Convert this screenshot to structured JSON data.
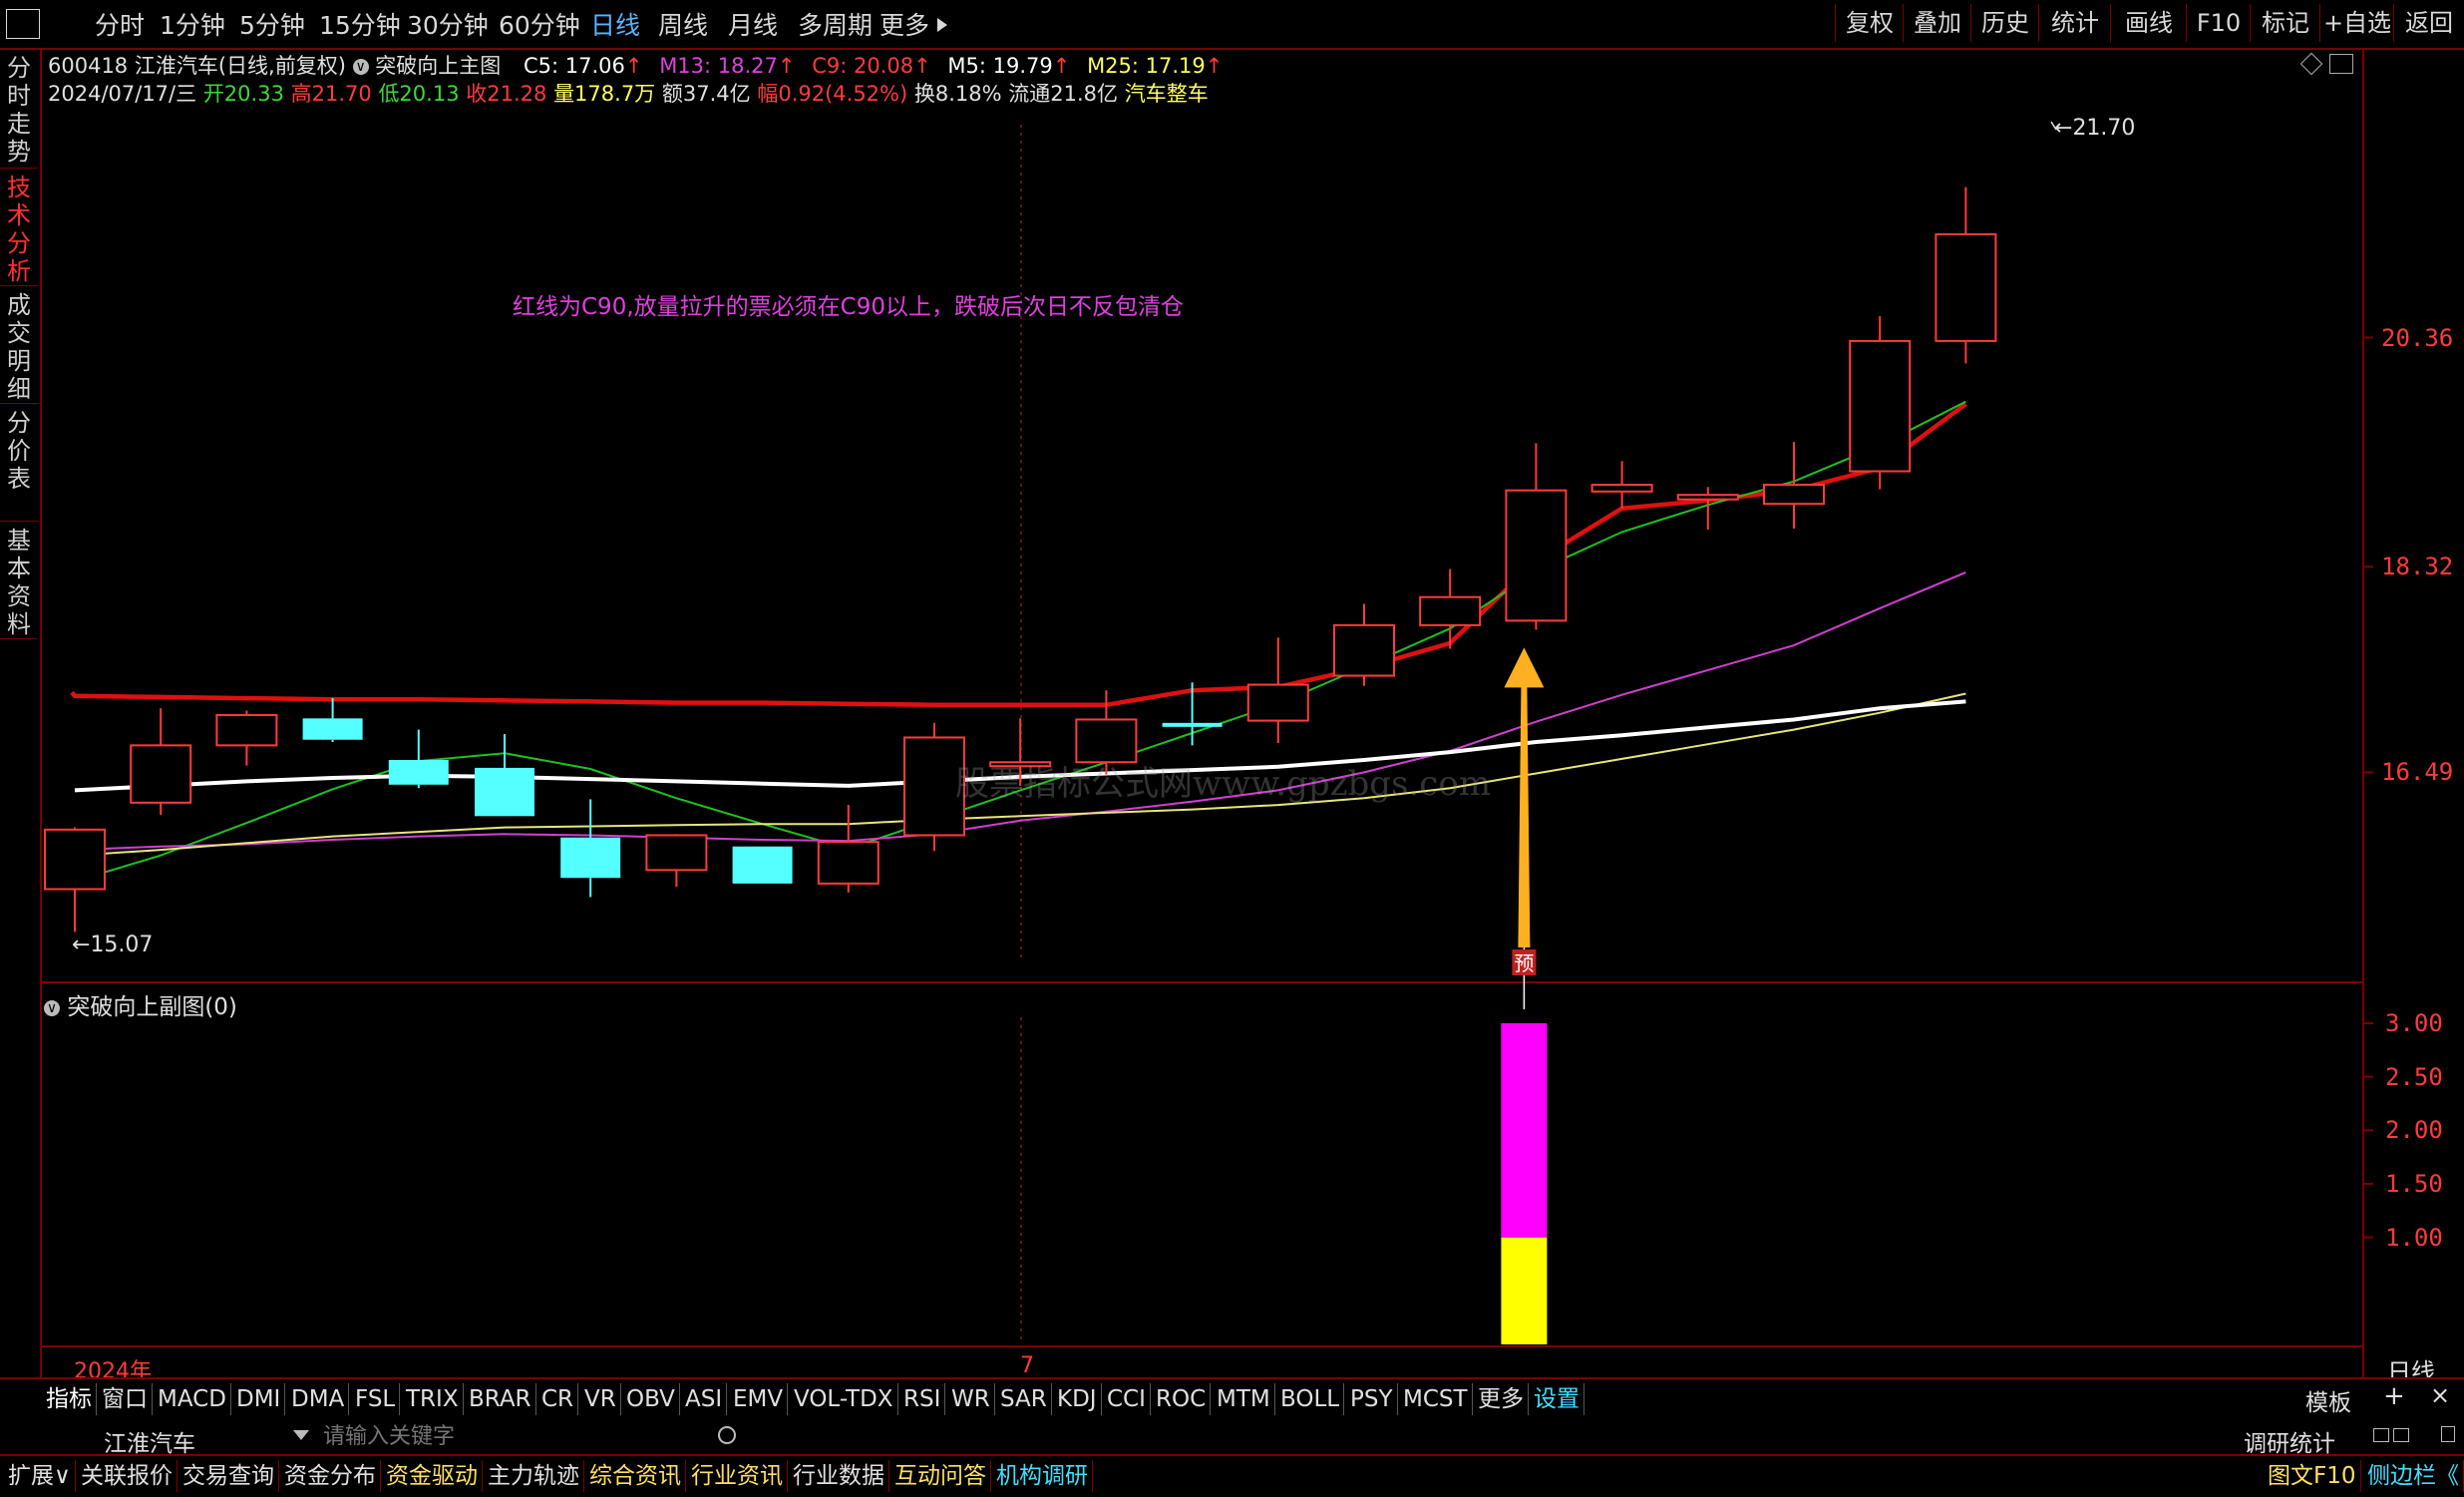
{
  "toolbar": {
    "periods": [
      "分时",
      "1分钟",
      "5分钟",
      "15分钟",
      "30分钟",
      "60分钟",
      "日线",
      "周线",
      "月线",
      "多周期",
      "更多"
    ],
    "selected_period": "日线",
    "right_buttons": [
      "复权",
      "叠加",
      "历史",
      "统计",
      "画线",
      "F10",
      "标记",
      "+自选",
      "返回"
    ]
  },
  "left_tabs": [
    "分时走势",
    "技术分析",
    "成交明细",
    "分价表",
    "基本资料"
  ],
  "selected_left_tab": "技术分析",
  "header": {
    "code": "600418",
    "name": "江淮汽车(日线,前复权)",
    "indicator": "突破向上主图",
    "c5": "C5: 17.06",
    "m13": "M13: 18.27",
    "c9": "C9: 20.08",
    "m5": "M5: 19.79",
    "m25": "M25: 17.19",
    "date": "2024/07/17/三",
    "open": "开20.33",
    "high": "高21.70",
    "low": "低20.13",
    "close": "收21.28",
    "volume": "量178.7万",
    "amount": "额37.4亿",
    "change": "幅0.92(4.52%)",
    "turnover": "换8.18%",
    "float": "流通21.8亿",
    "sector": "汽车整车"
  },
  "annotation": "红线为C90,放量拉升的票必须在C90以上，跌破后次日不反包清仓",
  "watermark": "股票指标公式网www.gpzbgs.com",
  "high_label": "21.70",
  "low_label": "15.07",
  "signal_label": "预",
  "price_axis": [
    "20.36",
    "18.32",
    "16.49"
  ],
  "sub_title": "突破向上副图(0)",
  "sub_axis": [
    "3.00",
    "2.50",
    "2.00",
    "1.50",
    "1.00"
  ],
  "time_axis": {
    "year": "2024年",
    "month": "7"
  },
  "period_label": "日线",
  "indicator_tabs": [
    "指标",
    "窗口",
    "MACD",
    "DMI",
    "DMA",
    "FSL",
    "TRIX",
    "BRAR",
    "CR",
    "VR",
    "OBV",
    "ASI",
    "EMV",
    "VOL-TDX",
    "RSI",
    "WR",
    "SAR",
    "KDJ",
    "CCI",
    "ROC",
    "MTM",
    "BOLL",
    "PSY",
    "MCST",
    "更多",
    "设置"
  ],
  "template_label": "模板",
  "plus_label": "+",
  "search": {
    "stock": "江淮汽车",
    "placeholder": "请输入关键字",
    "right_label": "调研统计"
  },
  "status_tabs": [
    "扩展∨",
    "关联报价",
    "交易查询",
    "资金分布",
    "资金驱动",
    "主力轨迹",
    "综合资讯",
    "行业资讯",
    "行业数据",
    "互动问答",
    "机构调研"
  ],
  "status_right": [
    "图文F10",
    "侧边栏《"
  ],
  "colors": {
    "up": "#ff3b3b",
    "down": "#54ffff",
    "c90": "#e01010",
    "ma_green": "#1ec21e",
    "ma_magenta": "#d040d0",
    "ma_white": "#ffffff",
    "ma_yellow": "#e6e67a",
    "border": "#7a0000"
  },
  "chart_data": {
    "type": "candlestick",
    "price_range": [
      14.7,
      22.3
    ],
    "candles": [
      {
        "o": 15.45,
        "h": 16.0,
        "c": 15.98,
        "l": 15.07
      },
      {
        "o": 16.22,
        "h": 17.06,
        "c": 16.73,
        "l": 16.11
      },
      {
        "o": 16.73,
        "h": 17.04,
        "c": 17.0,
        "l": 16.55
      },
      {
        "o": 16.97,
        "h": 17.15,
        "c": 16.78,
        "l": 16.76
      },
      {
        "o": 16.6,
        "h": 16.87,
        "c": 16.38,
        "l": 16.35
      },
      {
        "o": 16.53,
        "h": 16.83,
        "c": 16.1,
        "l": 16.1
      },
      {
        "o": 15.91,
        "h": 16.25,
        "c": 15.55,
        "l": 15.38
      },
      {
        "o": 15.62,
        "h": 15.94,
        "c": 15.93,
        "l": 15.47
      },
      {
        "o": 15.83,
        "h": 15.83,
        "c": 15.5,
        "l": 15.5
      },
      {
        "o": 15.5,
        "h": 16.2,
        "c": 15.87,
        "l": 15.42
      },
      {
        "o": 15.93,
        "h": 16.93,
        "c": 16.8,
        "l": 15.79
      },
      {
        "o": 16.58,
        "h": 16.97,
        "c": 16.58,
        "l": 16.37
      },
      {
        "o": 16.58,
        "h": 17.22,
        "c": 16.96,
        "l": 16.47
      },
      {
        "o": 16.93,
        "h": 17.29,
        "c": 16.9,
        "l": 16.73
      },
      {
        "o": 16.95,
        "h": 17.69,
        "c": 17.27,
        "l": 16.75
      },
      {
        "o": 17.35,
        "h": 17.99,
        "c": 17.8,
        "l": 17.26
      },
      {
        "o": 17.8,
        "h": 18.3,
        "c": 18.05,
        "l": 17.59
      },
      {
        "o": 17.84,
        "h": 19.42,
        "c": 19.0,
        "l": 17.76
      },
      {
        "o": 18.99,
        "h": 19.26,
        "c": 19.05,
        "l": 18.84
      },
      {
        "o": 18.92,
        "h": 19.03,
        "c": 18.96,
        "l": 18.65
      },
      {
        "o": 18.88,
        "h": 19.43,
        "c": 19.05,
        "l": 18.66
      },
      {
        "o": 19.17,
        "h": 20.55,
        "c": 20.33,
        "l": 19.01
      },
      {
        "o": 20.33,
        "h": 21.7,
        "c": 21.28,
        "l": 20.13
      }
    ],
    "series": [
      {
        "name": "C90",
        "values": [
          17.17,
          17.16,
          17.15,
          17.14,
          17.14,
          17.13,
          17.12,
          17.11,
          17.11,
          17.1,
          17.09,
          17.09,
          17.09,
          17.22,
          17.25,
          17.42,
          17.64,
          18.37,
          18.84,
          18.91,
          19.0,
          19.2,
          19.77
        ]
      },
      {
        "name": "M5",
        "values": [
          15.52,
          15.75,
          16.04,
          16.34,
          16.59,
          16.66,
          16.52,
          16.26,
          16.03,
          15.81,
          16.07,
          16.33,
          16.58,
          16.84,
          17.1,
          17.43,
          17.77,
          18.28,
          18.63,
          18.87,
          19.08,
          19.4,
          19.79
        ]
      },
      {
        "name": "M13",
        "values": [
          15.8,
          15.83,
          15.85,
          15.89,
          15.92,
          15.94,
          15.93,
          15.91,
          15.89,
          15.88,
          15.94,
          16.06,
          16.14,
          16.23,
          16.33,
          16.49,
          16.68,
          16.94,
          17.18,
          17.4,
          17.62,
          17.95,
          18.27
        ]
      },
      {
        "name": "M25",
        "values": [
          15.75,
          15.8,
          15.86,
          15.92,
          15.96,
          16.0,
          16.01,
          16.02,
          16.03,
          16.03,
          16.07,
          16.1,
          16.13,
          16.16,
          16.2,
          16.26,
          16.35,
          16.48,
          16.61,
          16.74,
          16.87,
          17.02,
          17.19
        ]
      },
      {
        "name": "C25",
        "values": [
          16.33,
          16.37,
          16.41,
          16.44,
          16.46,
          16.45,
          16.43,
          16.41,
          16.39,
          16.37,
          16.41,
          16.45,
          16.48,
          16.51,
          16.54,
          16.6,
          16.67,
          16.76,
          16.82,
          16.89,
          16.96,
          17.06,
          17.12
        ]
      }
    ],
    "signal_index": 17,
    "sub_chart": {
      "range": [
        0.0,
        3.0
      ],
      "index": 17,
      "segments": [
        {
          "from": 0.0,
          "to": 1.0,
          "color": "#ffff00"
        },
        {
          "from": 1.0,
          "to": 3.0,
          "color": "#ff00ff"
        }
      ]
    }
  }
}
